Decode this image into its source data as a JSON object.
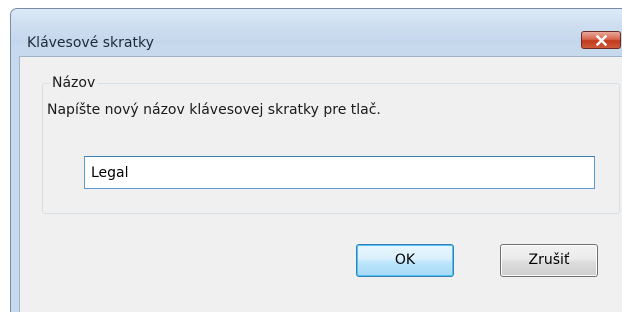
{
  "window": {
    "title": "Klávesové skratky",
    "close_icon": "close-icon"
  },
  "group": {
    "legend": "Názov",
    "instruction": "Napíšte nový názov klávesovej skratky pre tlač.",
    "name_value": "Legal"
  },
  "buttons": {
    "ok_label": "OK",
    "cancel_label": "Zrušiť"
  },
  "colors": {
    "titlebar": "#cfdff1",
    "close_button": "#c2391c",
    "dialog_background": "#f0f0f0",
    "input_border_focus": "#5b9bd5",
    "default_button_border": "#3c7fb1"
  }
}
